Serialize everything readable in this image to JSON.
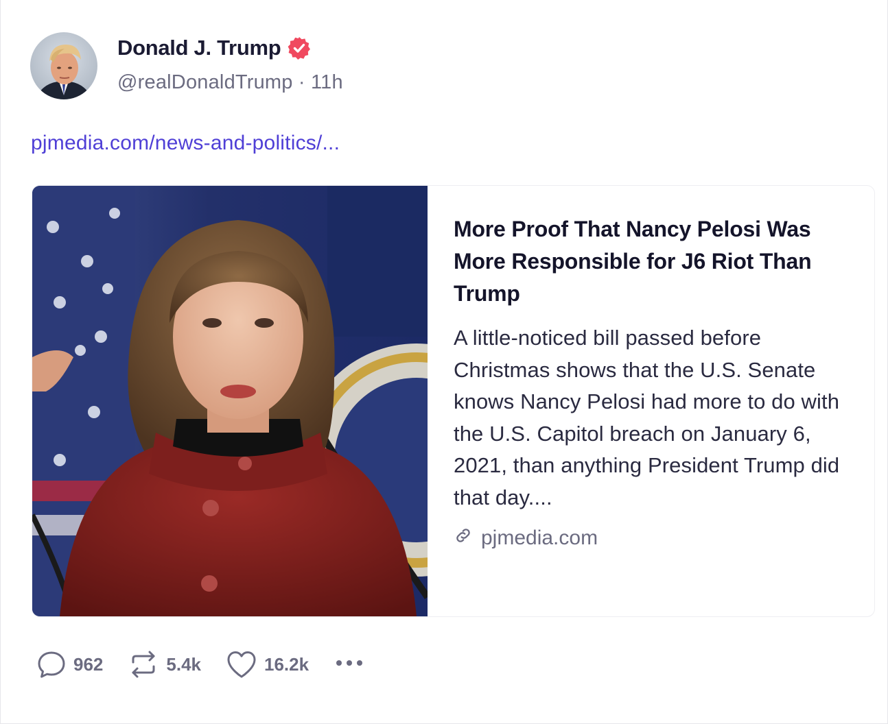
{
  "post": {
    "author": {
      "display_name": "Donald J. Trump",
      "handle": "@realDonaldTrump",
      "separator": "·",
      "time_ago": "11h",
      "verified_icon": "verified-badge-icon",
      "verified_color": "#f0495f"
    },
    "link_text": "pjmedia.com/news-and-politics/...",
    "link_color": "#4f3fd6",
    "card": {
      "title": "More Proof That Nancy Pelosi Was More Responsible for J6 Riot Than Trump",
      "description": "A little-noticed bill passed before Christmas shows that the U.S. Senate knows Nancy Pelosi had more to do with the U.S. Capitol breach on January 6, 2021, than anything President Trump did that day....",
      "domain": "pjmedia.com",
      "domain_icon": "link-icon"
    },
    "actions": {
      "replies": "962",
      "reposts": "5.4k",
      "likes": "16.2k",
      "reply_icon": "comment-icon",
      "repost_icon": "repost-icon",
      "like_icon": "heart-icon",
      "more_icon": "more-dots-icon"
    }
  }
}
